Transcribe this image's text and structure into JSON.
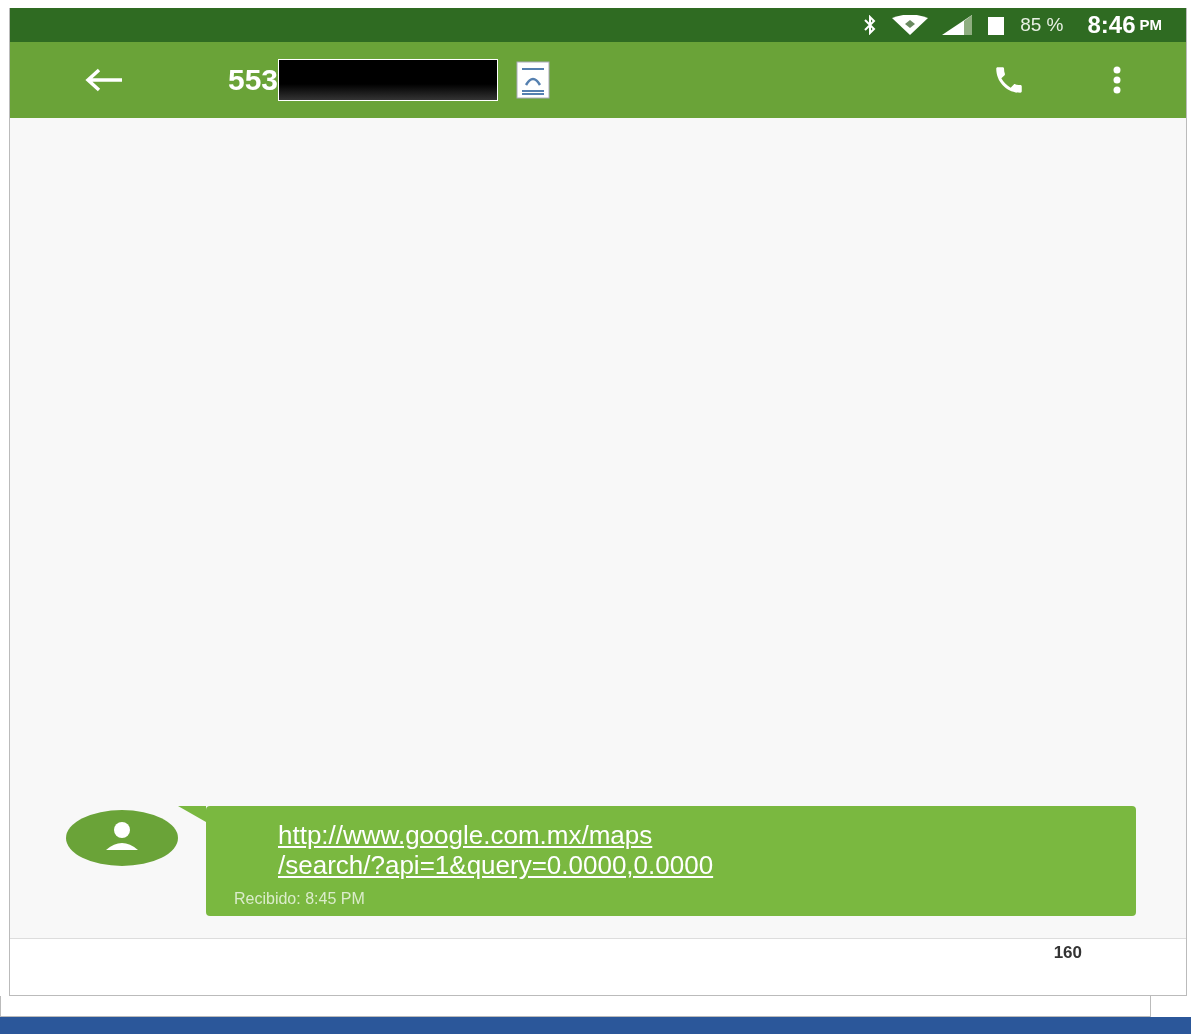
{
  "status_bar": {
    "battery": "85 %",
    "time": "8:46",
    "time_suffix": "PM"
  },
  "header": {
    "contact": "553"
  },
  "messages": [
    {
      "kind": "received",
      "link_lines": [
        "http://www.google.com.mx/maps",
        "/search/?api=1&query=0.0000,0.0000"
      ],
      "meta": "Recibido: 8:45 PM"
    }
  ],
  "compose": {
    "counter": "160"
  }
}
